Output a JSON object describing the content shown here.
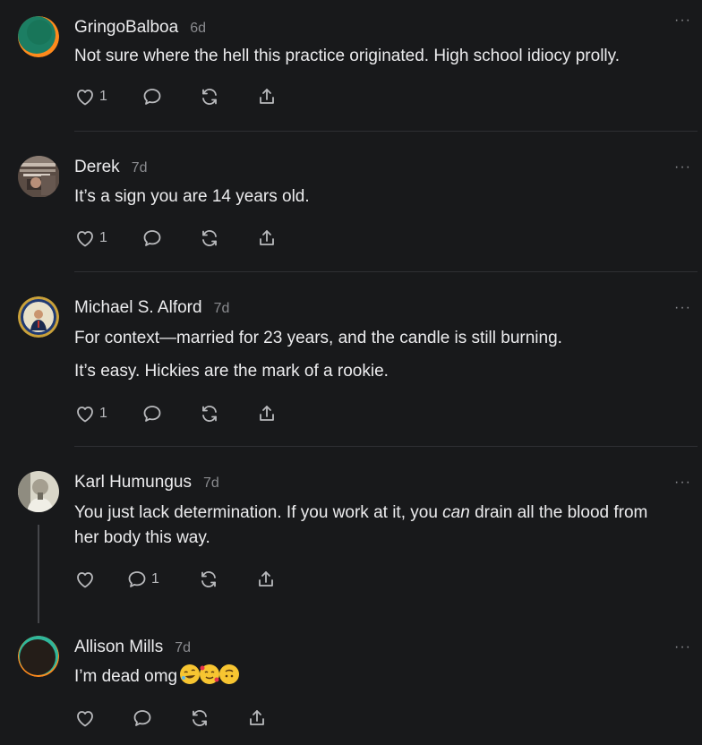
{
  "comments": [
    {
      "author": "GringoBalboa",
      "time": "6d",
      "body": [
        "Not sure where the hell this practice originated. High school idiocy prolly."
      ],
      "likes": "1",
      "replies": ""
    },
    {
      "author": "Derek",
      "time": "7d",
      "body": [
        "It’s a sign you are 14 years old."
      ],
      "likes": "1",
      "replies": ""
    },
    {
      "author": "Michael S. Alford",
      "time": "7d",
      "body": [
        "For context—married for 23 years, and the candle is still burning.",
        "It’s easy. Hickies are the mark of a rookie."
      ],
      "likes": "1",
      "replies": ""
    },
    {
      "author": "Karl Humungus",
      "time": "7d",
      "body_before": "You just lack determination. If you work at it, you ",
      "body_em": "can",
      "body_after": " drain all the blood from her body this way.",
      "likes": "",
      "replies": "1"
    },
    {
      "author": "Allison Mills",
      "time": "7d",
      "body": [
        "I’m dead omg"
      ],
      "emoji_names": [
        "rolling-on-floor-laughing",
        "smiling-face-with-hearts",
        "upside-down-face"
      ],
      "likes": "",
      "replies": ""
    }
  ],
  "more_label": "···",
  "icons": {
    "like": "heart-icon",
    "reply": "comment-icon",
    "restack": "restack-icon",
    "share": "share-icon"
  },
  "colors": {
    "background": "#18191b",
    "text": "#ececee",
    "muted": "#8a8b8f",
    "divider": "#2e2f33"
  }
}
